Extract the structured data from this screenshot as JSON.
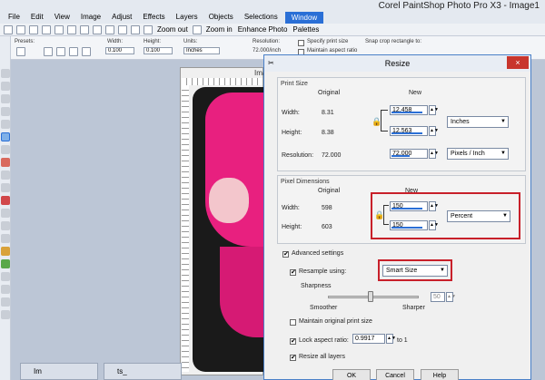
{
  "app": {
    "title": "Corel PaintShop Photo Pro X3 - Image1"
  },
  "menu": [
    "File",
    "Edit",
    "View",
    "Image",
    "Adjust",
    "Effects",
    "Layers",
    "Objects",
    "Selections",
    "Window"
  ],
  "toolbar": {
    "zoom_out": "Zoom out",
    "zoom_in": "Zoom in",
    "enhance_photo": "Enhance Photo",
    "palettes": "Palettes"
  },
  "tool_options": {
    "presets_label": "Presets:",
    "width_label": "Width:",
    "width_value": "0.100",
    "height_label": "Height:",
    "height_value": "0.100",
    "units_label": "Units:",
    "units_value": "Inches",
    "resolution_label": "Resolution:",
    "resolution_value": "72.000/inch",
    "specify_print_size": "Specify print size",
    "maintain_aspect_ratio": "Maintain aspect ratio",
    "snap_crop_label": "Snap crop rectangle to:"
  },
  "document": {
    "title": "Imag",
    "tabs": [
      "Im",
      "ts_"
    ]
  },
  "dialog": {
    "title": "Resize",
    "close": "×",
    "print_size": {
      "group_title": "Print Size",
      "original_header": "Original",
      "new_header": "New",
      "width_label": "Width:",
      "width_original": "8.31",
      "width_new": "12.458",
      "height_label": "Height:",
      "height_original": "8.38",
      "height_new": "12.563",
      "resolution_label": "Resolution:",
      "resolution_original": "72.000",
      "resolution_new": "72.000",
      "units": "Inches",
      "resolution_units": "Pixels / Inch"
    },
    "pixel_dimensions": {
      "group_title": "Pixel Dimensions",
      "original_header": "Original",
      "new_header": "New",
      "width_label": "Width:",
      "width_original": "598",
      "width_new": "150",
      "height_label": "Height:",
      "height_original": "603",
      "height_new": "150",
      "units": "Percent"
    },
    "advanced": {
      "advanced_settings": "Advanced settings",
      "resample_using": "Resample using:",
      "resample_method": "Smart Size",
      "sharpness_label": "Sharpness",
      "sharpness_value": "50",
      "smoother": "Smoother",
      "sharper": "Sharper",
      "maintain_original_print_size": "Maintain original print size",
      "lock_aspect_ratio": "Lock aspect ratio:",
      "aspect_ratio_value": "0.9917",
      "aspect_to": "to 1",
      "resize_all_layers": "Resize all layers"
    },
    "buttons": {
      "ok": "OK",
      "cancel": "Cancel",
      "help": "Help"
    }
  }
}
